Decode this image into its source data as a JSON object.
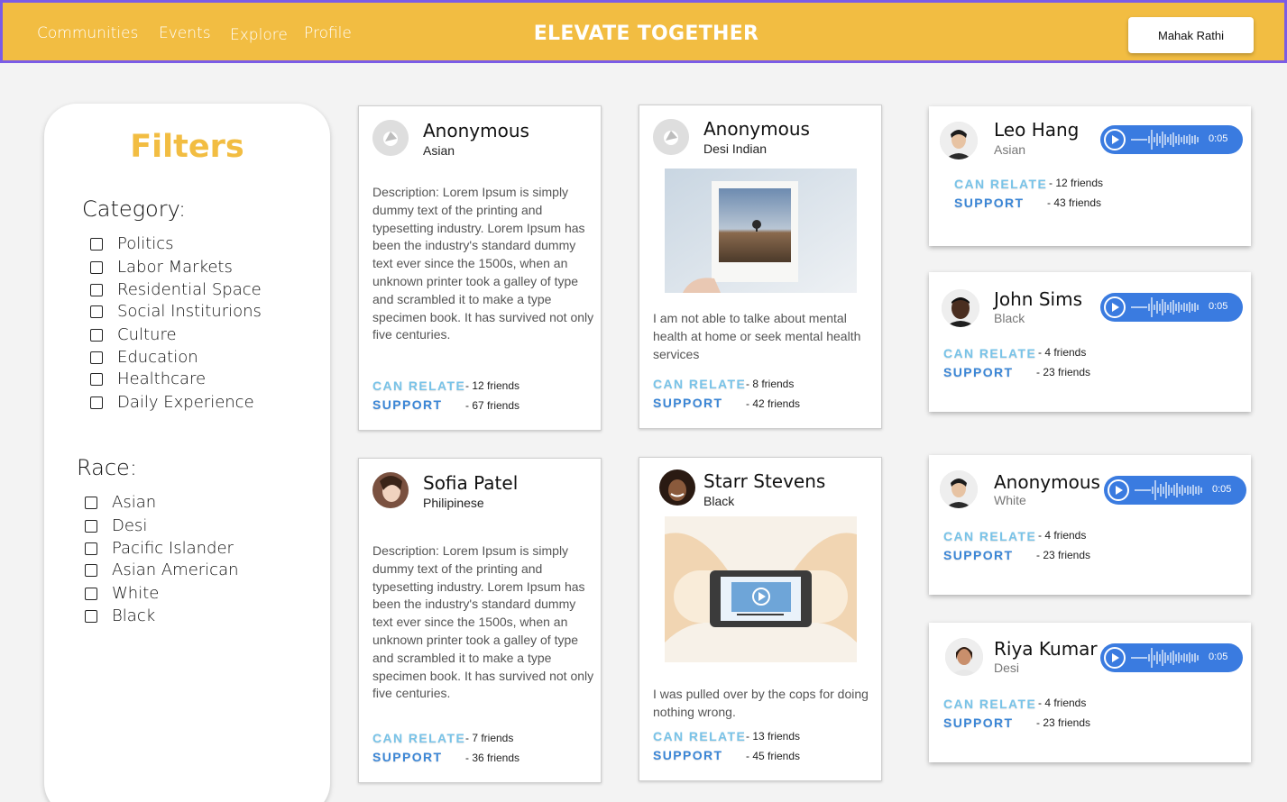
{
  "header": {
    "nav": [
      "Communities",
      "Events",
      "Explore",
      "Profile"
    ],
    "brand": "ELEVATE TOGETHER",
    "user": "Mahak Rathi"
  },
  "filters": {
    "title": "Filters",
    "category_title": "Category:",
    "categories": [
      "Politics",
      "Labor Markets",
      "Residential Space",
      "Social Institurions",
      "Culture",
      "Education",
      "Healthcare",
      "Daily Experience"
    ],
    "race_title": "Race:",
    "races": [
      "Asian",
      "Desi",
      "Pacific Islander",
      "Asian American",
      "White",
      "Black"
    ]
  },
  "labels": {
    "can_relate": "CAN RELATE",
    "support": "SUPPORT"
  },
  "posts": [
    {
      "name": "Anonymous",
      "race": "Asian",
      "description": "Description: Lorem Ipsum is simply dummy text of the printing and typesetting industry. Lorem Ipsum has been the industry's standard dummy text ever since the 1500s, when an unknown printer took a galley of type and scrambled it to make a type specimen book. It has survived not only five centuries.",
      "can_relate": "- 12 friends",
      "support": "- 67 friends"
    },
    {
      "name": "Anonymous",
      "race": "Desi Indian",
      "description": "I am not able to talke about mental health at home or seek mental health services",
      "can_relate": "- 8 friends",
      "support": "- 42 friends"
    },
    {
      "name": "Sofia Patel",
      "race": "Philipinese",
      "description": "Description: Lorem Ipsum is simply dummy text of the printing and typesetting industry. Lorem Ipsum has been the industry's standard dummy text ever since the 1500s, when an unknown printer took a galley of type and scrambled it to make a type specimen book. It has survived not only five centuries.",
      "can_relate": "- 7 friends",
      "support": "- 36 friends"
    },
    {
      "name": "Starr Stevens",
      "race": "Black",
      "description": "I was pulled over by the cops for doing nothing wrong.",
      "can_relate": "- 13 friends",
      "support": "- 45 friends"
    }
  ],
  "voice_posts": [
    {
      "name": "Leo Hang",
      "race": "Asian",
      "duration": "0:05",
      "can_relate": "- 12 friends",
      "support": "- 43 friends"
    },
    {
      "name": "John Sims",
      "race": "Black",
      "duration": "0:05",
      "can_relate": "- 4 friends",
      "support": "- 23 friends"
    },
    {
      "name": "Anonymous",
      "race": "White",
      "duration": "0:05",
      "can_relate": "- 4 friends",
      "support": "- 23 friends"
    },
    {
      "name": "Riya Kumar",
      "race": "Desi",
      "duration": "0:05",
      "can_relate": "- 4 friends",
      "support": "- 23 friends"
    }
  ],
  "colors": {
    "header_bg": "#f2bd42",
    "header_border": "#7b5ce6",
    "can_relate": "#78c3e8",
    "support": "#3b86d6",
    "audio": "#3a7be0"
  }
}
